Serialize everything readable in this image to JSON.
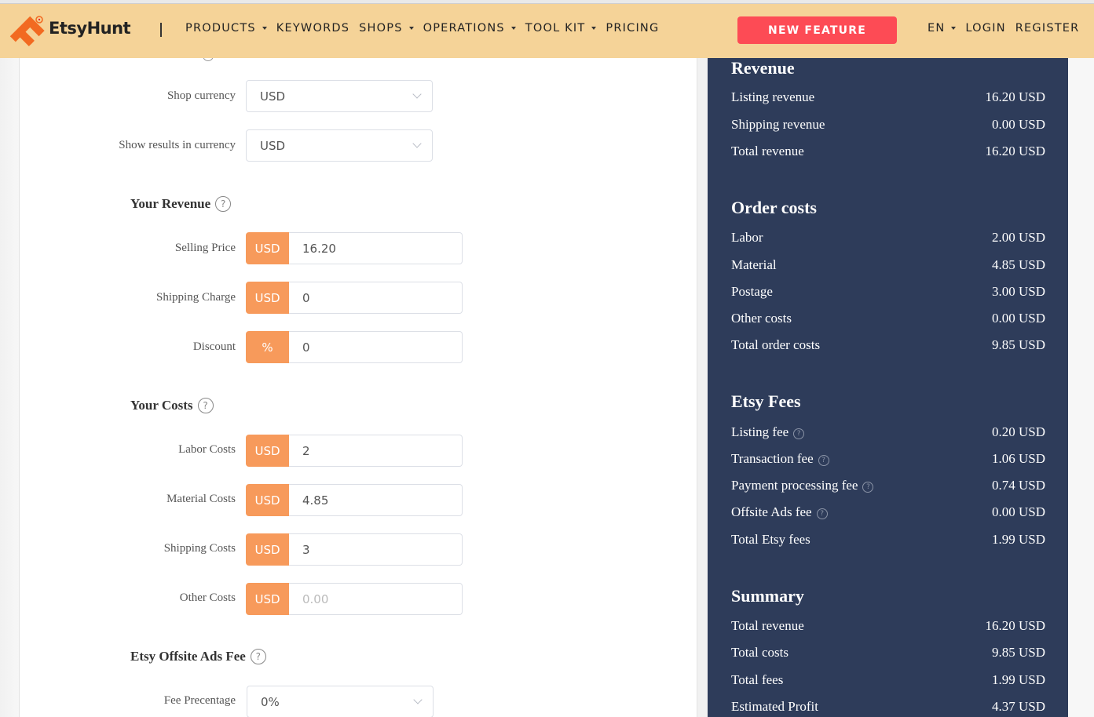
{
  "header": {
    "brand": "EtsyHunt",
    "nav": [
      {
        "label": "PRODUCTS",
        "dropdown": true
      },
      {
        "label": "KEYWORDS",
        "dropdown": false
      },
      {
        "label": "SHOPS",
        "dropdown": true
      },
      {
        "label": "OPERATIONS",
        "dropdown": true
      },
      {
        "label": "TOOL KIT",
        "dropdown": true
      },
      {
        "label": "PRICING",
        "dropdown": false
      }
    ],
    "new_feature": "NEW FEATURE",
    "language": "EN",
    "login": "LOGIN",
    "register": "REGISTER",
    "colors": {
      "header_bg": "#f5d398",
      "cta": "#fd4b55",
      "logo": "#f26a21"
    }
  },
  "form": {
    "shop_currency": {
      "label": "Shop currency",
      "value": "USD"
    },
    "results_currency": {
      "label": "Show results in currency",
      "value": "USD"
    },
    "revenue": {
      "title": "Your Revenue",
      "fields": [
        {
          "label": "Selling Price",
          "unit": "USD",
          "value": "16.20"
        },
        {
          "label": "Shipping Charge",
          "unit": "USD",
          "value": "0"
        },
        {
          "label": "Discount",
          "unit": "%",
          "value": "0"
        }
      ]
    },
    "costs": {
      "title": "Your Costs",
      "fields": [
        {
          "label": "Labor Costs",
          "unit": "USD",
          "value": "2"
        },
        {
          "label": "Material Costs",
          "unit": "USD",
          "value": "4.85"
        },
        {
          "label": "Shipping Costs",
          "unit": "USD",
          "value": "3"
        },
        {
          "label": "Other Costs",
          "unit": "USD",
          "placeholder": "0.00"
        }
      ]
    },
    "offsite_ads": {
      "title": "Etsy Offsite Ads Fee",
      "fee_label": "Fee Precentage",
      "fee_value": "0%"
    },
    "addon_color": "#f79a5b"
  },
  "summary": {
    "bg_color": "#2e3c5a",
    "revenue": {
      "title": "Revenue",
      "rows": [
        {
          "label": "Listing revenue",
          "value": "16.20 USD"
        },
        {
          "label": "Shipping revenue",
          "value": "0.00 USD"
        },
        {
          "label": "Total revenue",
          "value": "16.20 USD"
        }
      ]
    },
    "order_costs": {
      "title": "Order costs",
      "rows": [
        {
          "label": "Labor",
          "value": "2.00 USD"
        },
        {
          "label": "Material",
          "value": "4.85 USD"
        },
        {
          "label": "Postage",
          "value": "3.00 USD"
        },
        {
          "label": "Other costs",
          "value": "0.00 USD"
        },
        {
          "label": "Total order costs",
          "value": "9.85 USD"
        }
      ]
    },
    "etsy_fees": {
      "title": "Etsy Fees",
      "rows": [
        {
          "label": "Listing fee",
          "value": "0.20 USD",
          "help": true
        },
        {
          "label": "Transaction fee",
          "value": "1.06 USD",
          "help": true
        },
        {
          "label": "Payment processing fee",
          "value": "0.74 USD",
          "help": true
        },
        {
          "label": "Offsite Ads fee",
          "value": "0.00 USD",
          "help": true
        },
        {
          "label": "Total Etsy fees",
          "value": "1.99 USD"
        }
      ]
    },
    "summary": {
      "title": "Summary",
      "rows": [
        {
          "label": "Total revenue",
          "value": "16.20 USD"
        },
        {
          "label": "Total costs",
          "value": "9.85 USD"
        },
        {
          "label": "Total fees",
          "value": "1.99 USD"
        },
        {
          "label": "Estimated Profit",
          "value": "4.37 USD"
        }
      ]
    }
  }
}
